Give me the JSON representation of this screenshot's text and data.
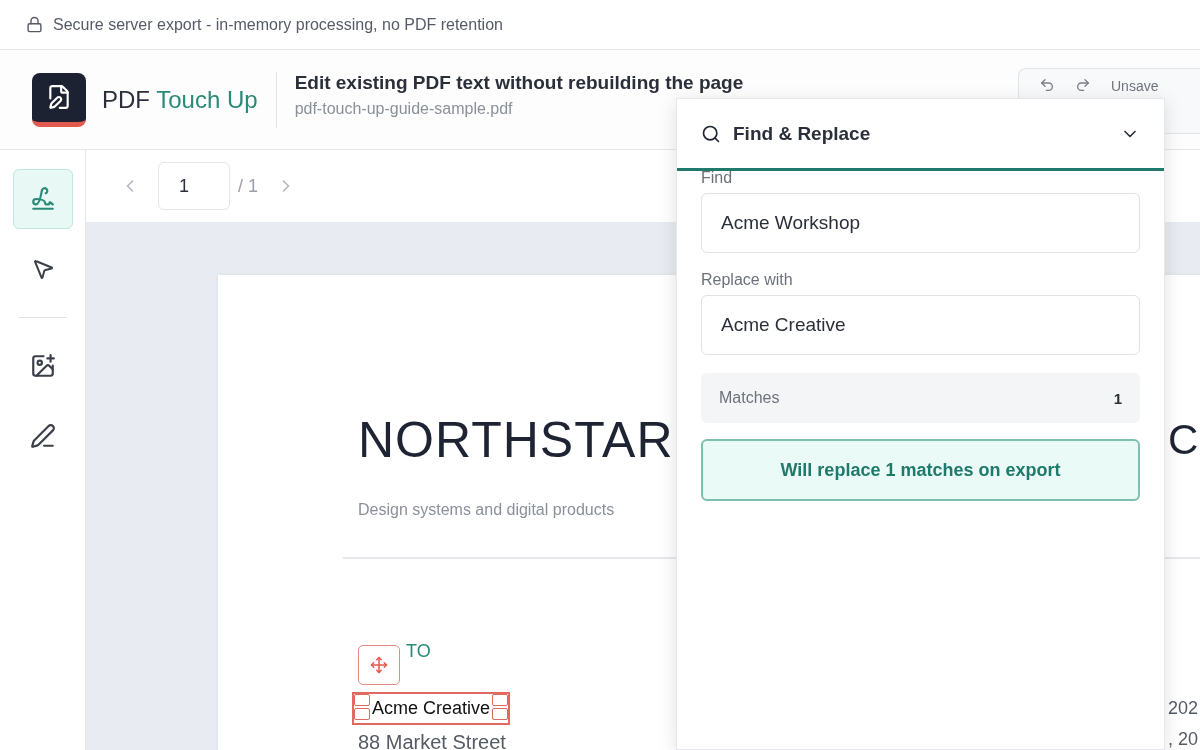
{
  "banner": {
    "text": "Secure server export - in-memory processing, no PDF retention"
  },
  "brand": {
    "name": "PDF",
    "accent": "Touch Up"
  },
  "document": {
    "title": "Edit existing PDF text without rebuilding the page",
    "file": "pdf-touch-up-guide-sample.pdf"
  },
  "history": {
    "status": "Unsave"
  },
  "tool_groups": [
    [
      {
        "kind": "signature",
        "selected": true
      },
      {
        "kind": "select",
        "selected": false
      }
    ],
    [
      {
        "kind": "image",
        "selected": false
      },
      {
        "kind": "pen",
        "selected": false
      }
    ]
  ],
  "pager": {
    "page": "1",
    "total": "/ 1"
  },
  "page": {
    "title": "NORTHSTAR",
    "title_end": "C",
    "tagline": "Design systems and digital products",
    "to_label": "TO",
    "edited_text": "Acme Creative",
    "address": "88 Market Street",
    "right_lines": [
      "202",
      ", 20"
    ]
  },
  "find_replace": {
    "title": "Find & Replace",
    "find_label": "Find",
    "find_value": "Acme Workshop",
    "replace_label": "Replace with",
    "replace_value": "Acme Creative",
    "matches_label": "Matches",
    "matches_count": "1",
    "action": "Will replace 1 matches on export"
  }
}
